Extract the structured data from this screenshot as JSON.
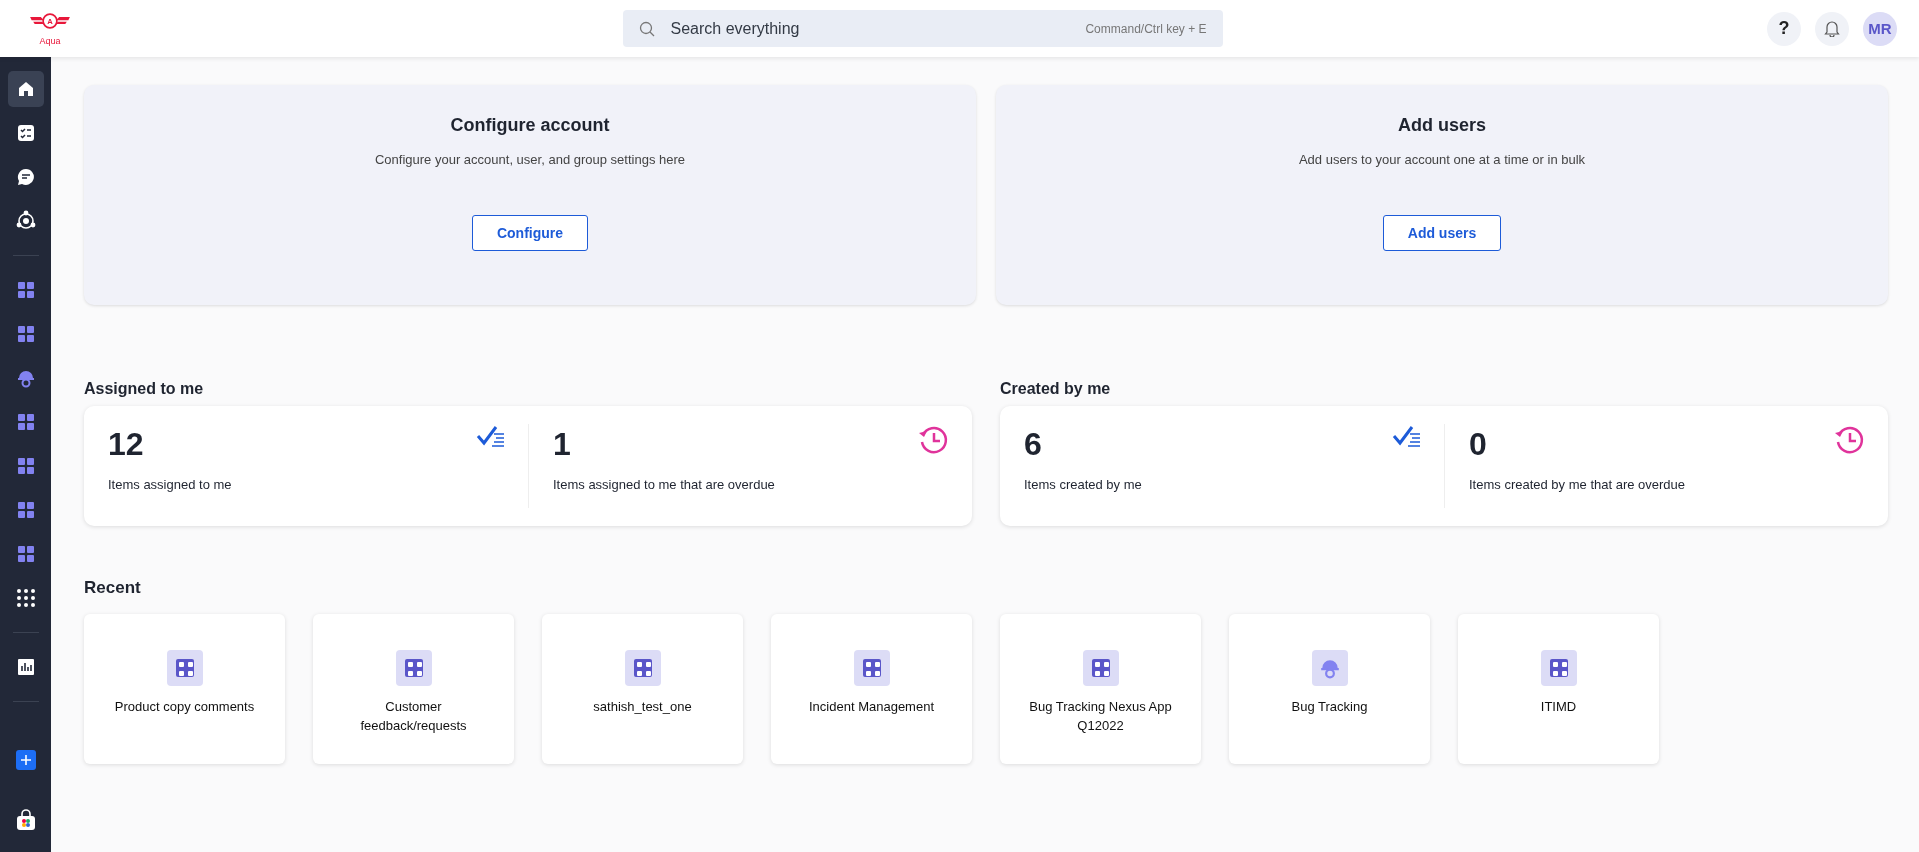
{
  "logo": {
    "letter": "A",
    "name": "Aqua"
  },
  "search": {
    "placeholder": "Search everything",
    "shortcut": "Command/Ctrl key + E"
  },
  "header": {
    "help": "?",
    "avatar": "MR"
  },
  "sidebar": {
    "groups": [
      [
        {
          "kind": "home",
          "selected": true
        },
        {
          "kind": "checklist",
          "selected": false
        },
        {
          "kind": "chat",
          "selected": false
        },
        {
          "kind": "hub",
          "selected": false
        }
      ],
      [
        {
          "kind": "grid",
          "selected": false
        },
        {
          "kind": "grid",
          "selected": false
        },
        {
          "kind": "helmet",
          "selected": false
        },
        {
          "kind": "grid",
          "selected": false
        },
        {
          "kind": "grid",
          "selected": false
        },
        {
          "kind": "grid",
          "selected": false
        },
        {
          "kind": "grid",
          "selected": false
        },
        {
          "kind": "dots",
          "selected": false
        }
      ],
      [
        {
          "kind": "chart",
          "selected": false
        }
      ]
    ],
    "bottom": [
      {
        "kind": "plus",
        "selected": false
      },
      {
        "kind": "store",
        "selected": false
      }
    ]
  },
  "promos": [
    {
      "title": "Configure account",
      "text": "Configure your account, user, and group settings here",
      "button": "Configure"
    },
    {
      "title": "Add users",
      "text": "Add users to your account one at a time or in bulk",
      "button": "Add users"
    }
  ],
  "stat_groups": [
    {
      "title": "Assigned to me",
      "stats": [
        {
          "value": "12",
          "label": "Items assigned to me",
          "kind": "done"
        },
        {
          "value": "1",
          "label": "Items assigned to me that are overdue",
          "kind": "overdue"
        }
      ]
    },
    {
      "title": "Created by me",
      "stats": [
        {
          "value": "6",
          "label": "Items created by me",
          "kind": "done"
        },
        {
          "value": "0",
          "label": "Items created by me that are overdue",
          "kind": "overdue"
        }
      ]
    }
  ],
  "recent": {
    "title": "Recent",
    "items": [
      {
        "name": "Product copy comments",
        "kind": "grid"
      },
      {
        "name": "Customer feedback/requests",
        "kind": "grid"
      },
      {
        "name": "sathish_test_one",
        "kind": "grid"
      },
      {
        "name": "Incident Management",
        "kind": "grid"
      },
      {
        "name": "Bug Tracking Nexus App Q12022",
        "kind": "grid"
      },
      {
        "name": "Bug Tracking",
        "kind": "helmet"
      },
      {
        "name": "ITIMD",
        "kind": "grid"
      }
    ]
  }
}
